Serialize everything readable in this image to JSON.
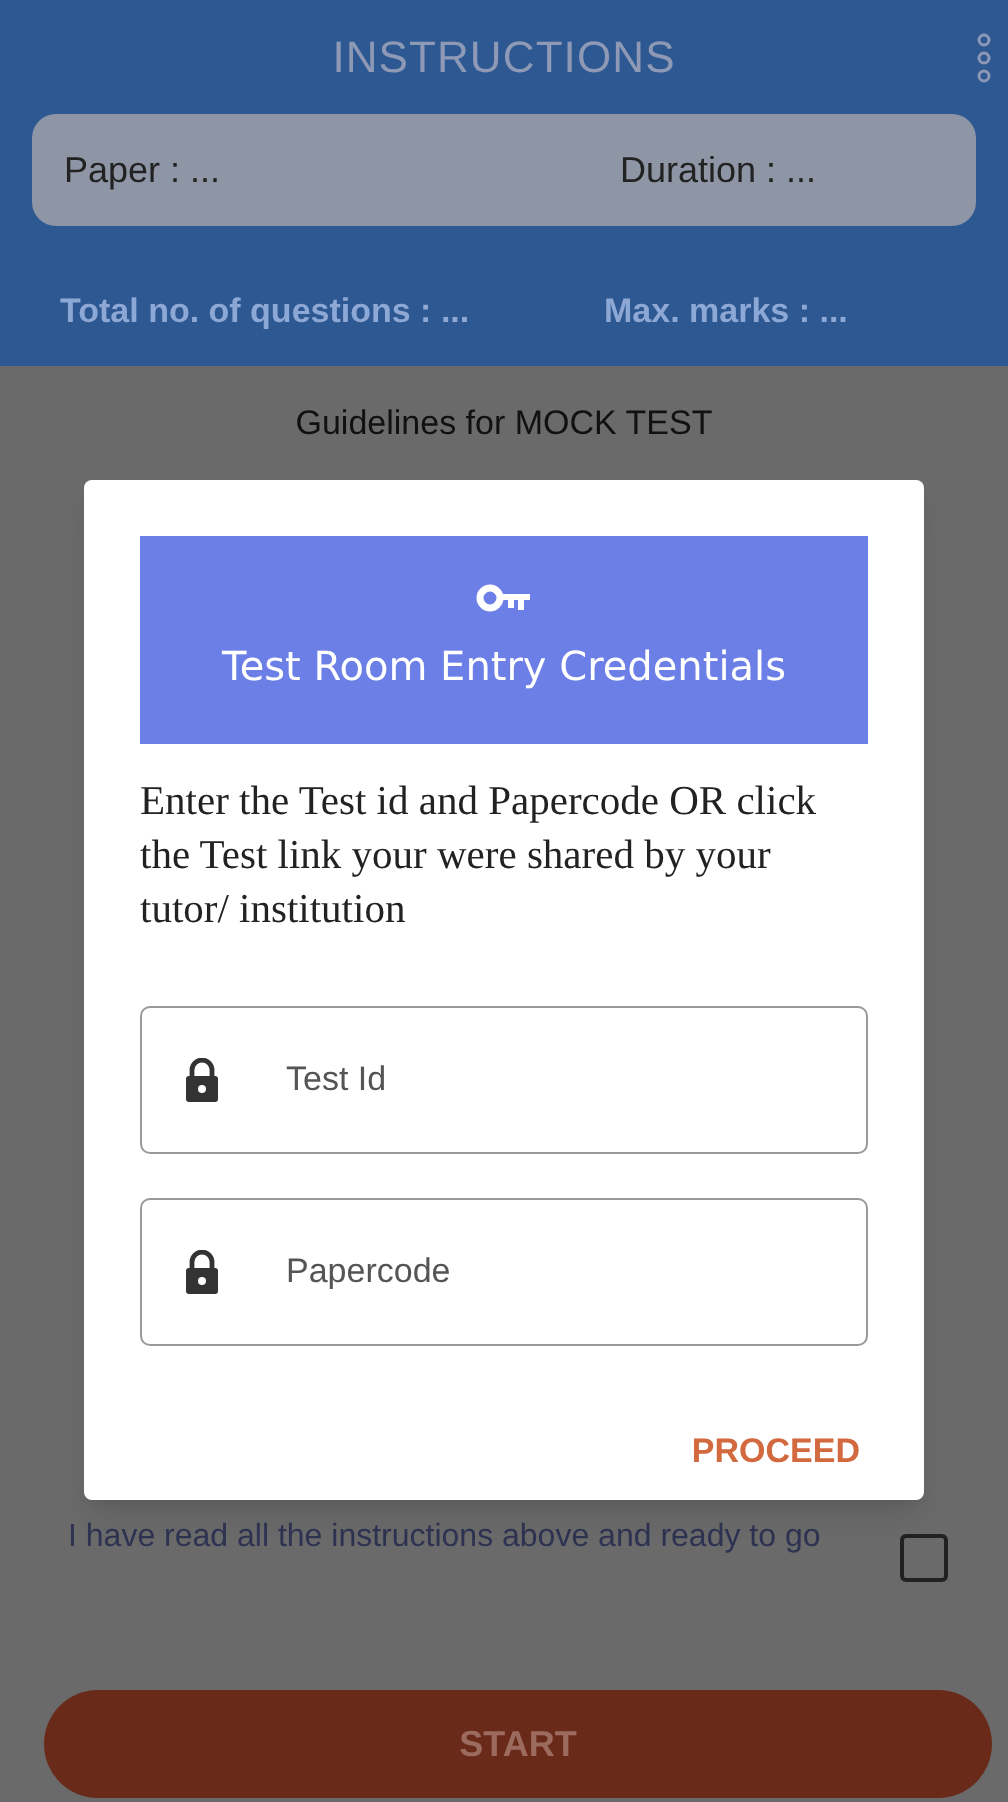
{
  "header": {
    "title": "INSTRUCTIONS",
    "paper": "Paper : ...",
    "duration": "Duration : ...",
    "total_questions": "Total no. of questions : ...",
    "max_marks": "Max. marks : ..."
  },
  "guidelines_title": "Guidelines for MOCK TEST",
  "agreement": {
    "label": "I have read all the instructions above and ready to go",
    "checked": false
  },
  "start_button": "START",
  "dialog": {
    "title": "Test Room Entry Credentials",
    "description": "Enter the Test id and Papercode OR click the Test link your were shared by your tutor/ institution",
    "fields": [
      {
        "placeholder": "Test Id"
      },
      {
        "placeholder": "Papercode"
      }
    ],
    "proceed": "PROCEED"
  }
}
